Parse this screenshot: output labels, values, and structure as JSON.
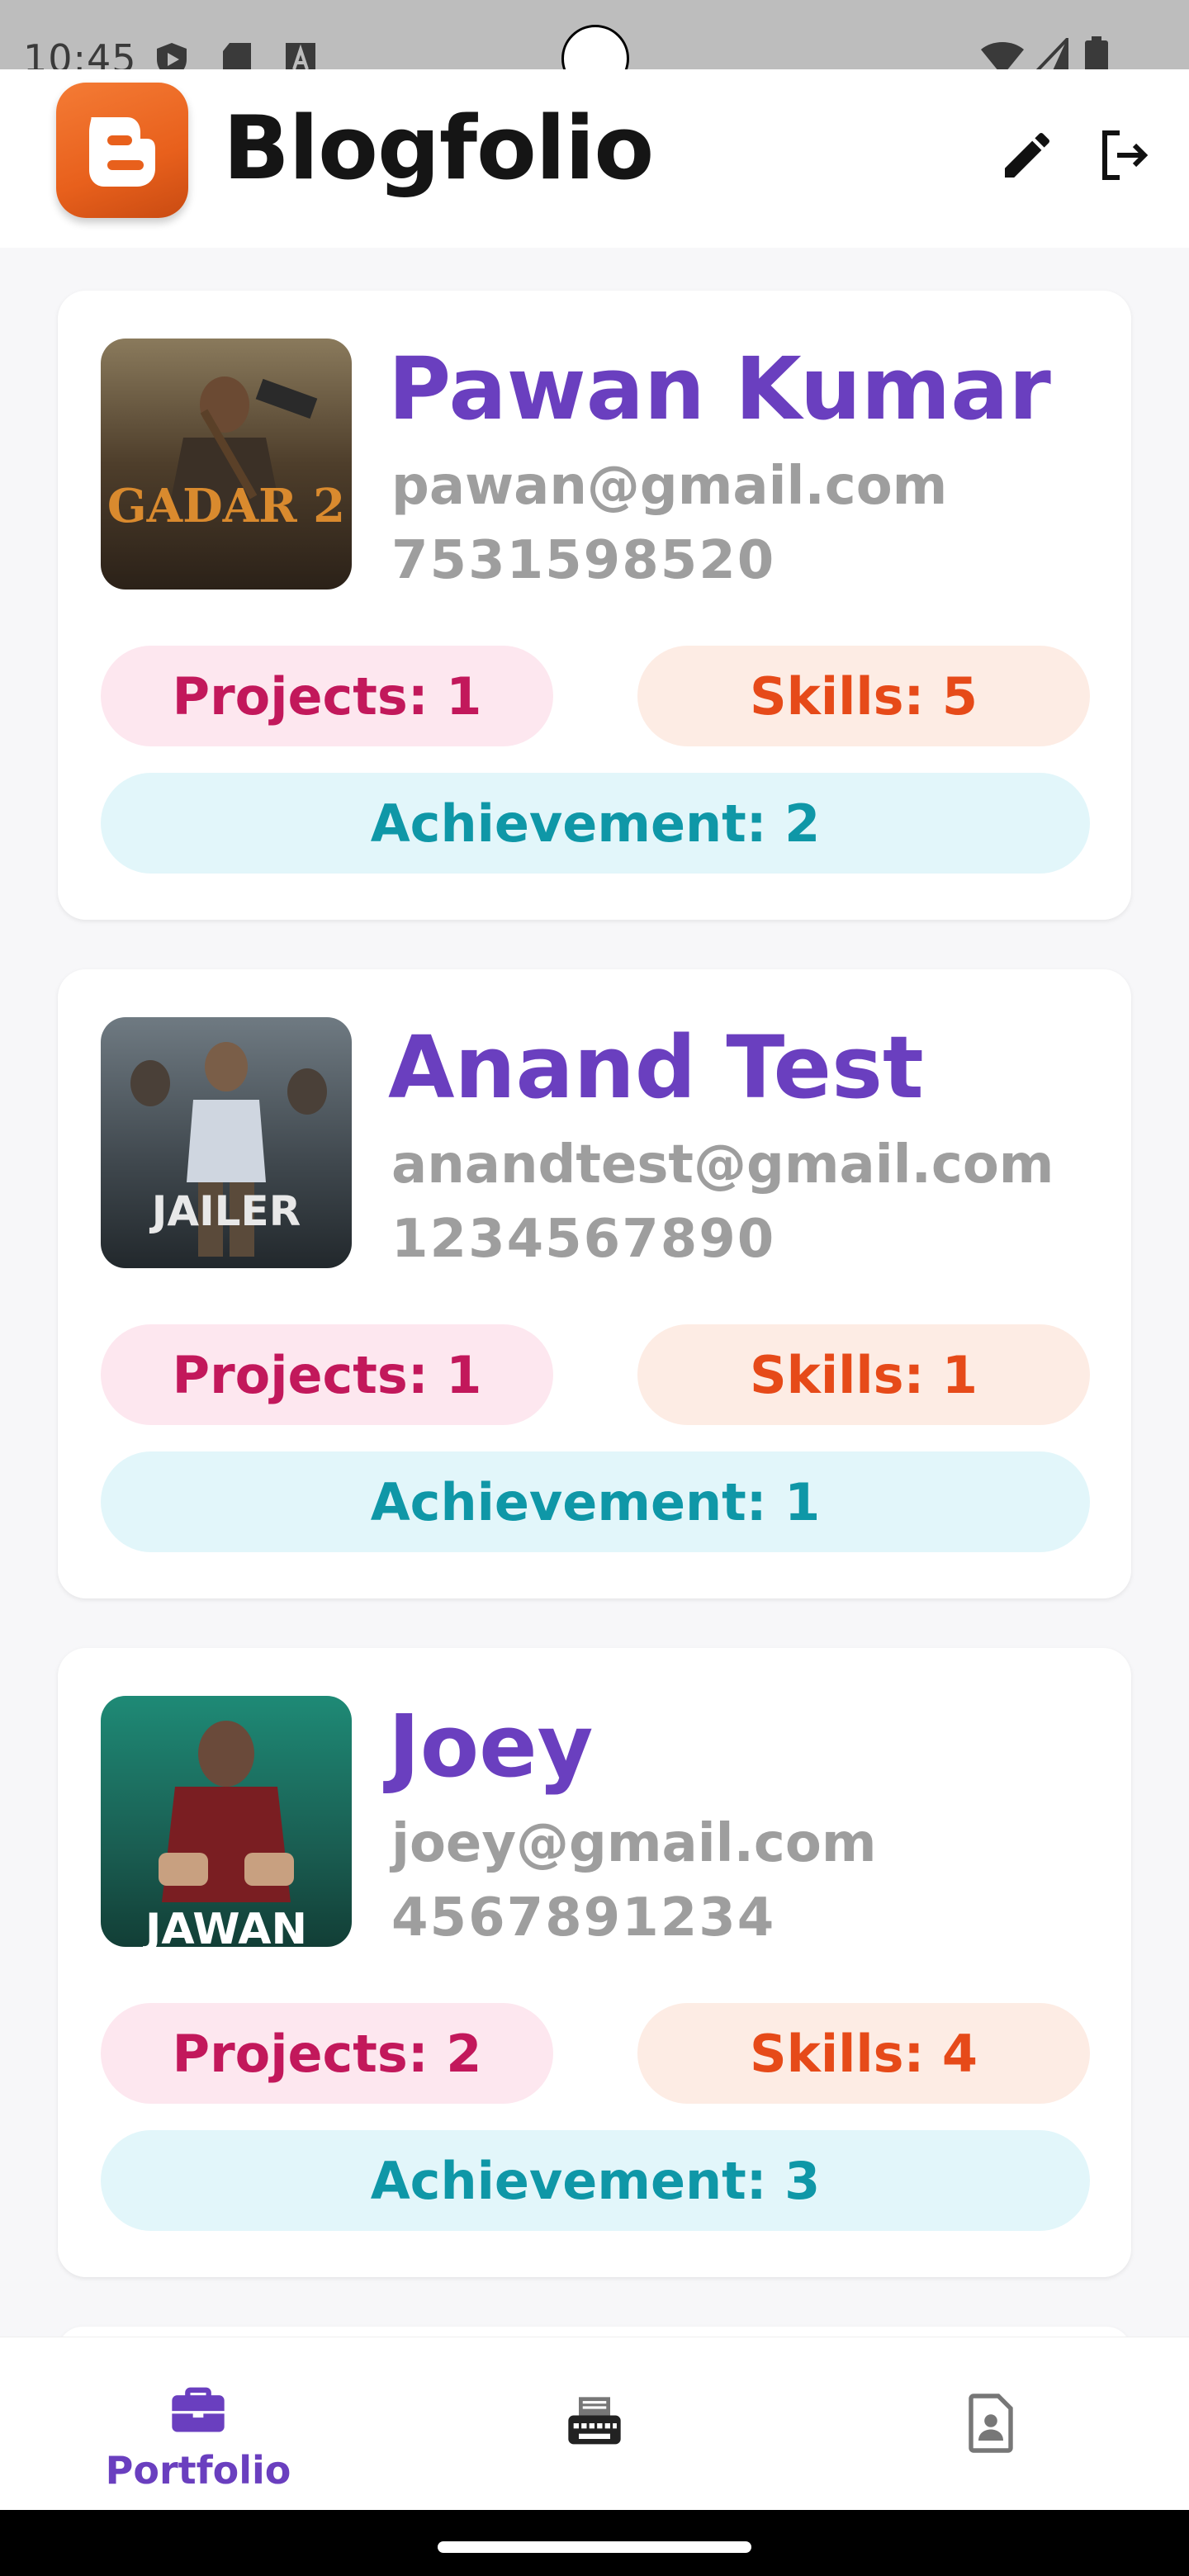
{
  "status_bar": {
    "time": "10:45"
  },
  "app_bar": {
    "title": "Blogfolio"
  },
  "profiles": [
    {
      "name": "Pawan Kumar",
      "email": "pawan@gmail.com",
      "phone": "7531598520",
      "projects": "Projects: 1",
      "skills": "Skills: 5",
      "achievement": "Achievement: 2",
      "poster_text": "GADAR 2"
    },
    {
      "name": "Anand Test",
      "email": "anandtest@gmail.com",
      "phone": "1234567890",
      "projects": "Projects: 1",
      "skills": "Skills: 1",
      "achievement": "Achievement: 1",
      "poster_text": "JAILER"
    },
    {
      "name": "Joey",
      "email": "joey@gmail.com",
      "phone": "4567891234",
      "projects": "Projects: 2",
      "skills": "Skills: 4",
      "achievement": "Achievement: 3",
      "poster_text": "JAWAN"
    }
  ],
  "bottom_nav": {
    "items": [
      {
        "label": "Portfolio",
        "icon": "briefcase-icon",
        "active": true
      },
      {
        "label": "",
        "icon": "typewriter-icon",
        "active": false
      },
      {
        "label": "",
        "icon": "contact-page-icon",
        "active": false
      }
    ]
  },
  "colors": {
    "accent": "#6a3fbf",
    "projects_bg": "#fde7ef",
    "projects_fg": "#c2185b",
    "skills_bg": "#fdece4",
    "skills_fg": "#e64a19",
    "achievement_bg": "#e2f6fa",
    "achievement_fg": "#0f97a7"
  }
}
